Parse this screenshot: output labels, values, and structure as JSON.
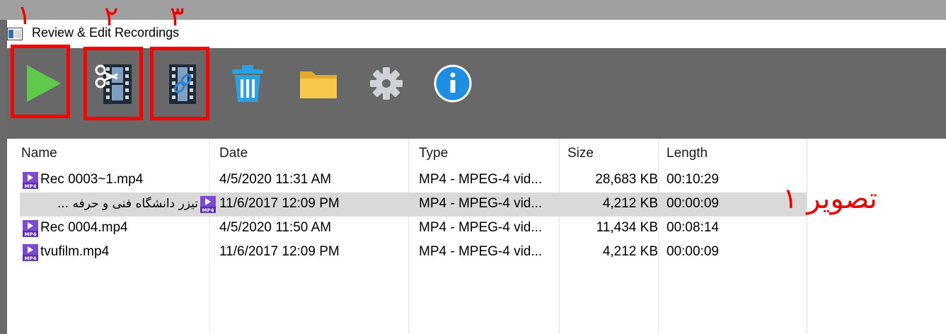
{
  "window": {
    "title": "Review & Edit Recordings"
  },
  "toolbar": {
    "buttons": [
      {
        "icon": "play-icon"
      },
      {
        "icon": "cut-video-icon"
      },
      {
        "icon": "join-video-icon"
      },
      {
        "icon": "trash-icon"
      },
      {
        "icon": "folder-icon"
      },
      {
        "icon": "gear-icon"
      },
      {
        "icon": "info-icon"
      }
    ]
  },
  "annotations": {
    "marker1": "١",
    "marker2": "٢",
    "marker3": "٣",
    "caption": "تصویر ۱",
    "color": "#ee0000"
  },
  "list": {
    "columns": [
      "Name",
      "Date",
      "Type",
      "Size",
      "Length"
    ],
    "rows": [
      {
        "name": "Rec 0003~1.mp4",
        "date": "4/5/2020 11:31 AM",
        "type": "MP4 - MPEG-4 vid...",
        "size": "28,683 KB",
        "length": "00:10:29",
        "selected": false
      },
      {
        "name": "تیزر دانشگاه فنی و حرفه ...",
        "date": "11/6/2017 12:09 PM",
        "type": "MP4 - MPEG-4 vid...",
        "size": "4,212 KB",
        "length": "00:00:09",
        "selected": true
      },
      {
        "name": "Rec 0004.mp4",
        "date": "4/5/2020 11:50 AM",
        "type": "MP4 - MPEG-4 vid...",
        "size": "11,434 KB",
        "length": "00:08:14",
        "selected": false
      },
      {
        "name": "tvufilm.mp4",
        "date": "11/6/2017 12:09 PM",
        "type": "MP4 - MPEG-4 vid...",
        "size": "4,212 KB",
        "length": "00:00:09",
        "selected": false
      }
    ]
  },
  "colors": {
    "toolbar": "#686868",
    "highlight": "#ff0000",
    "selected_row": "#d9d9d9"
  }
}
